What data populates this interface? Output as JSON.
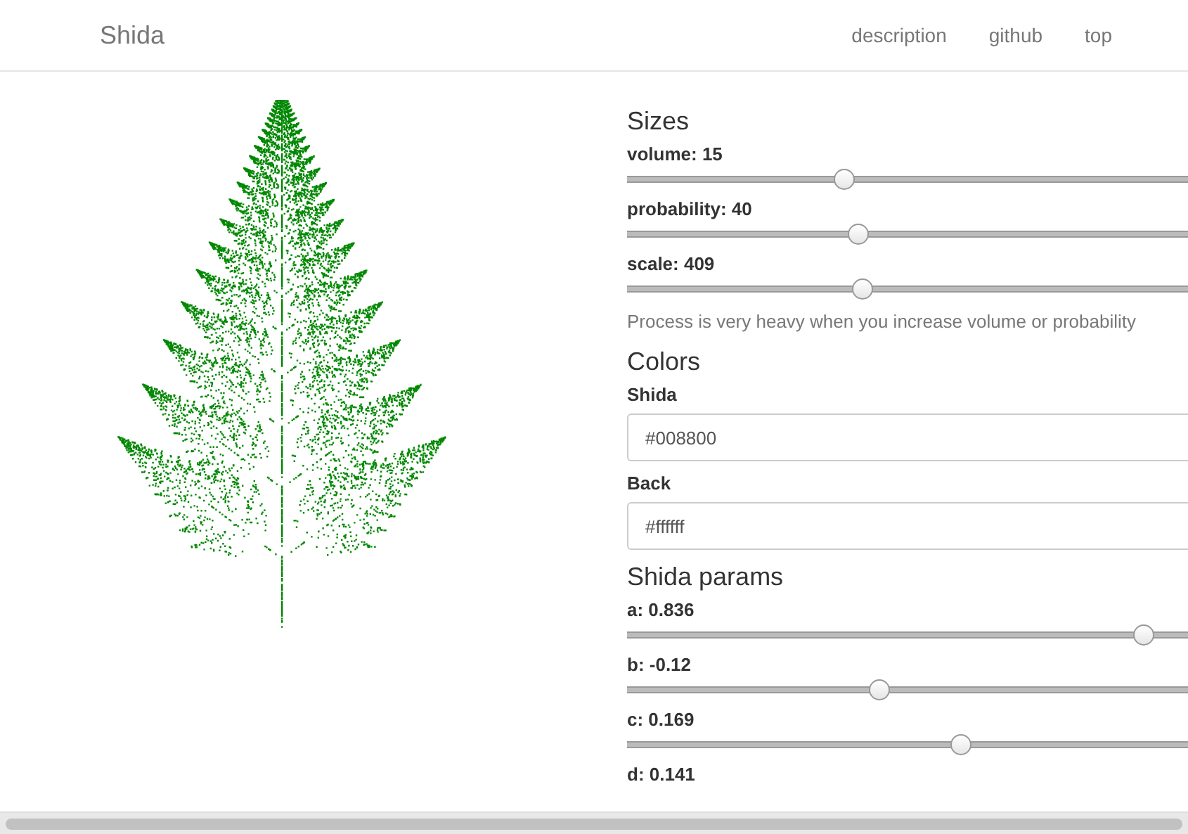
{
  "navbar": {
    "brand": "Shida",
    "links": [
      "description",
      "github",
      "top"
    ]
  },
  "sizes": {
    "title": "Sizes",
    "sliders": [
      {
        "label": "volume: 15",
        "level": 0.275
      },
      {
        "label": "probability: 40",
        "level": 0.293
      },
      {
        "label": "scale: 409",
        "level": 0.298
      }
    ],
    "note": "Process is very heavy when you increase volume or probability"
  },
  "colors": {
    "title": "Colors",
    "fields": [
      {
        "label": "Shida",
        "value": "#008800"
      },
      {
        "label": "Back",
        "value": "#ffffff"
      }
    ]
  },
  "params": {
    "title": "Shida params",
    "sliders": [
      {
        "label": "a: 0.836",
        "level": 0.655
      },
      {
        "label": "b: -0.12",
        "level": 0.32
      },
      {
        "label": "c: 0.169",
        "level": 0.423
      }
    ],
    "cut_label": "d: 0.141"
  }
}
